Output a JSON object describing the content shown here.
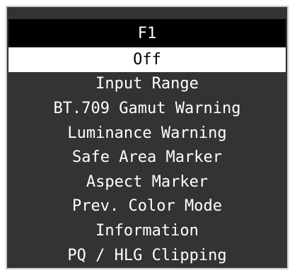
{
  "menu": {
    "title": "F1",
    "items": [
      {
        "label": "Off",
        "selected": true
      },
      {
        "label": "Input Range",
        "selected": false
      },
      {
        "label": "BT.709 Gamut Warning",
        "selected": false
      },
      {
        "label": "Luminance Warning",
        "selected": false
      },
      {
        "label": "Safe Area Marker",
        "selected": false
      },
      {
        "label": "Aspect Marker",
        "selected": false
      },
      {
        "label": "Prev. Color Mode",
        "selected": false
      },
      {
        "label": "Information",
        "selected": false
      },
      {
        "label": "PQ / HLG Clipping",
        "selected": false
      }
    ]
  },
  "colors": {
    "panel_background": "#333333",
    "title_background": "#000000",
    "selected_background": "#ffffff",
    "selected_text": "#000000",
    "text": "#ffffff",
    "border": "#c8c8c8"
  }
}
